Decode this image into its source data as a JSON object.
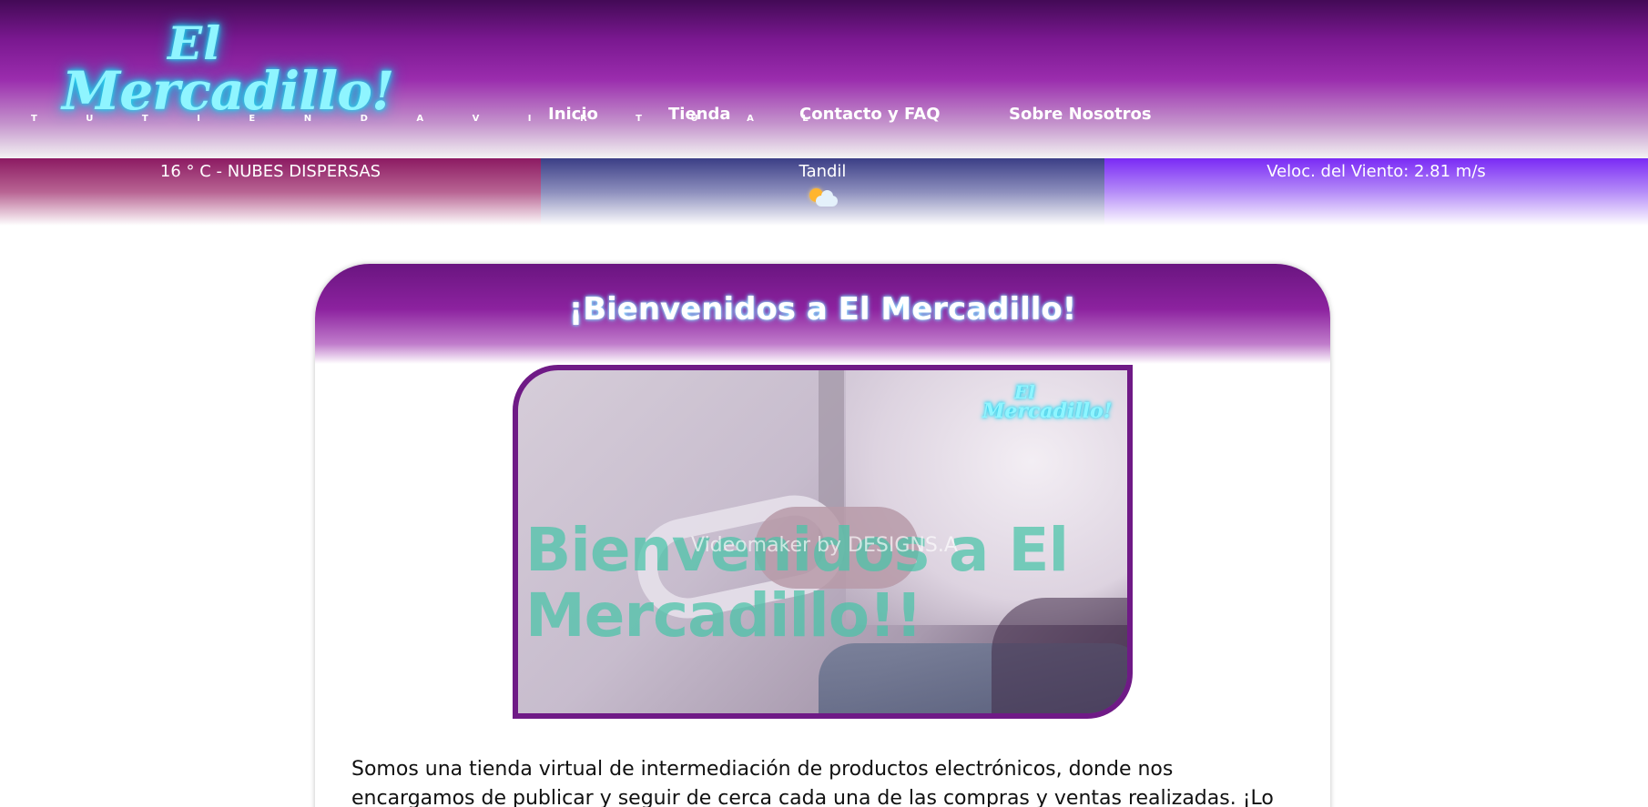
{
  "header": {
    "logo": {
      "line1": "El",
      "line2": "Mercadillo!",
      "tagline": "T U T I E N D A V I R T U A L"
    },
    "nav": [
      {
        "label": "Inicio"
      },
      {
        "label": "Tienda"
      },
      {
        "label": "Contacto y FAQ"
      },
      {
        "label": "Sobre Nosotros"
      }
    ]
  },
  "weather": {
    "temperature_text": "16 ° C - NUBES DISPERSAS",
    "city": "Tandil",
    "icon": "sun-behind-cloud-icon",
    "wind_text": "Veloc. del Viento: 2.81 m/s"
  },
  "main": {
    "title": "¡Bienvenidos a El Mercadillo!",
    "video": {
      "logo_line1": "El",
      "logo_line2": "Mercadillo!",
      "headline": "Bienvenidos a El Mercadillo!!",
      "watermark": "Videomaker by DESIGNS.A"
    },
    "intro": "Somos una tienda virtual de intermediación de productos electrónicos, donde nos encargamos de publicar y seguir de cerca cada una de las compras y ventas realizadas. ¡Lo"
  },
  "colors": {
    "header_top": "#430a56",
    "header_mid": "#9a2cad",
    "neon": "#8ff5ff",
    "weather_left": "#8c1a62",
    "weather_center": "#3b3e86",
    "weather_right": "#7a2af5",
    "video_border": "#6f1a86"
  }
}
